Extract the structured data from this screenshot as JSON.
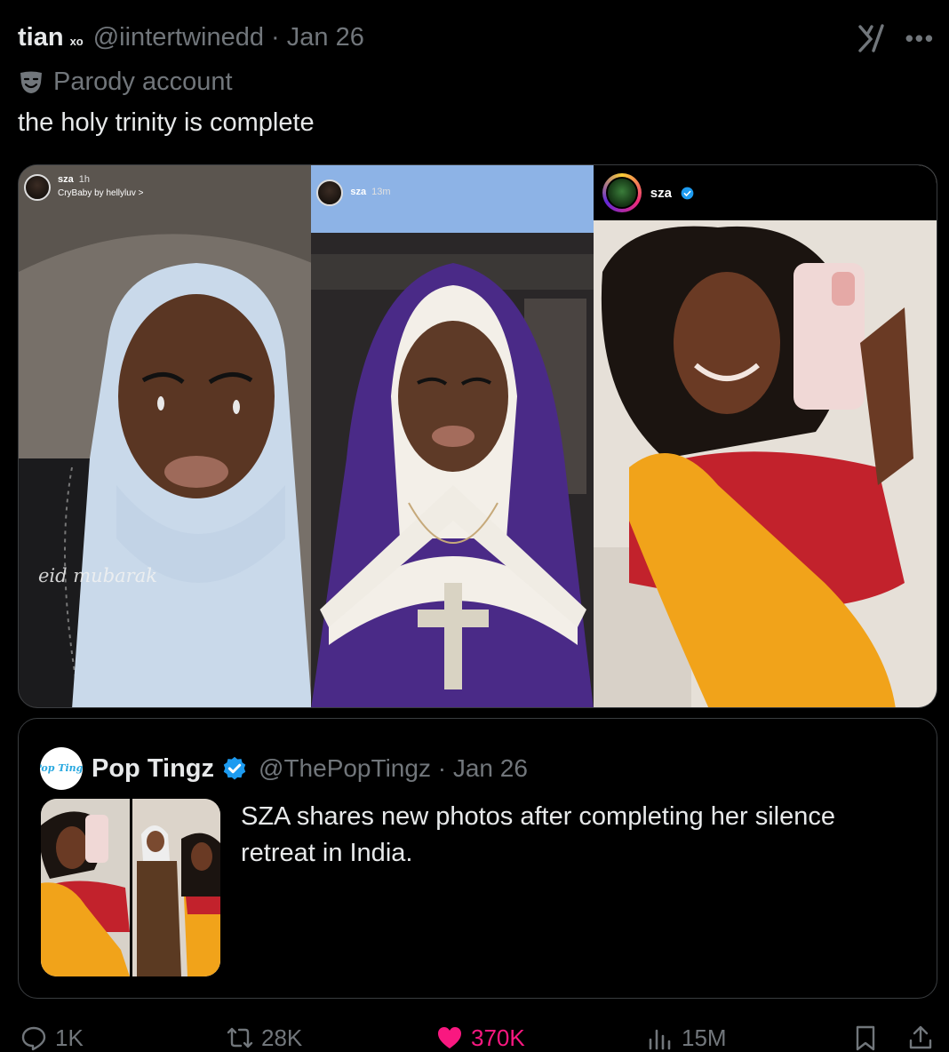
{
  "tweet": {
    "author_name": "tian",
    "author_badge": "xo",
    "handle": "@iintertwinedd",
    "date": "Jan 26",
    "handle_date": "@iintertwinedd · Jan 26",
    "parody_label": "Parody account",
    "text": "the holy trinity is complete"
  },
  "media": {
    "panel1": {
      "story_user": "sza",
      "story_time": "1h",
      "story_song": "CryBaby by hellyluv >",
      "caption": "eid mubarak"
    },
    "panel2": {
      "story_user": "sza",
      "story_time": "13m"
    },
    "panel3": {
      "ig_user": "sza"
    }
  },
  "quoted": {
    "logo_text": "Pop Tingz",
    "name": "Pop Tingz",
    "handle_date": "@ThePopTingz · Jan 26",
    "text": "SZA shares new photos after completing her silence retreat in India."
  },
  "actions": {
    "replies": "1K",
    "reposts": "28K",
    "likes": "370K",
    "views": "15M"
  },
  "colors": {
    "background": "#000000",
    "text_primary": "#e7e9ea",
    "text_secondary": "#71767b",
    "like_pink": "#f91880",
    "verified_blue": "#1d9bf0",
    "border": "#3a3d40"
  }
}
